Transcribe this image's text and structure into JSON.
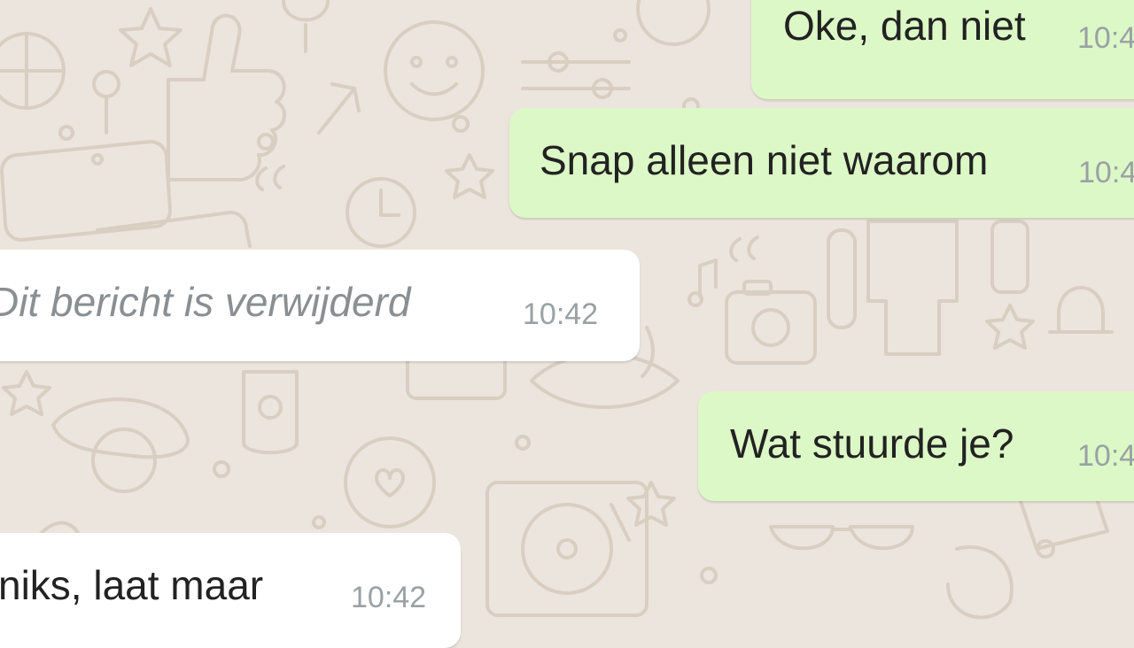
{
  "chat": {
    "messages": [
      {
        "text": "Oke, dan niet",
        "time": "10:4",
        "direction": "outgoing"
      },
      {
        "text": "Snap alleen niet waarom",
        "time": "10:4",
        "direction": "outgoing"
      },
      {
        "text": "Dit bericht is verwijderd",
        "time": "10:42",
        "direction": "incoming",
        "deleted": true
      },
      {
        "text": "Wat stuurde je?",
        "time": "10:4",
        "direction": "outgoing"
      },
      {
        "text": "niks, laat maar",
        "time": "10:42",
        "direction": "incoming"
      }
    ]
  },
  "colors": {
    "background": "#ece5dd",
    "outgoing_bubble": "#dcf8c6",
    "incoming_bubble": "#ffffff",
    "timestamp": "#9aa1a5",
    "deleted_text": "#8a8f93",
    "doodle_stroke": "#d9d0c4"
  }
}
